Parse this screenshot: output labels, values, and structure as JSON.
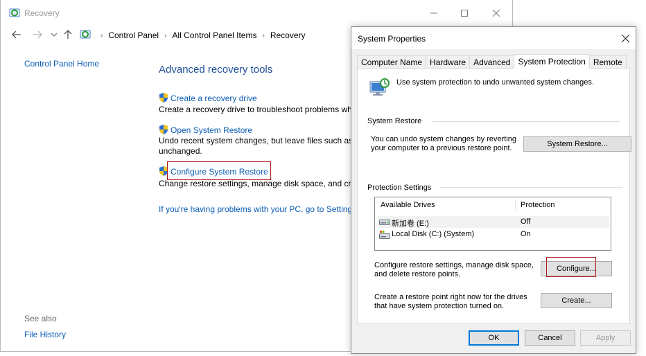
{
  "cp_window": {
    "title": "Recovery",
    "breadcrumb": [
      "Control Panel",
      "All Control Panel Items",
      "Recovery"
    ],
    "left_nav": {
      "home": "Control Panel Home",
      "see_also": "See also",
      "file_history": "File History"
    },
    "heading": "Advanced recovery tools",
    "tasks": [
      {
        "link": "Create a recovery drive",
        "desc": [
          "Create a recovery drive to troubleshoot problems whe"
        ]
      },
      {
        "link": "Open System Restore",
        "desc": [
          "Undo recent system changes, but leave files such as d",
          "unchanged."
        ]
      },
      {
        "link": "Configure System Restore",
        "desc": [
          "Change restore settings, manage disk space, and crea"
        ]
      }
    ],
    "problem_link": "If you're having problems with your PC, go to Setting"
  },
  "sp_dialog": {
    "title": "System Properties",
    "tabs": [
      "Computer Name",
      "Hardware",
      "Advanced",
      "System Protection",
      "Remote"
    ],
    "active_tab": "System Protection",
    "intro": "Use system protection to undo unwanted system changes.",
    "system_restore": {
      "label": "System Restore",
      "desc": "You can undo system changes by reverting your computer to a previous restore point.",
      "button": "System Restore..."
    },
    "protection": {
      "label": "Protection Settings",
      "columns": [
        "Available Drives",
        "Protection"
      ],
      "drives": [
        {
          "name": "新加卷 (E:)",
          "protection": "Off"
        },
        {
          "name": "Local Disk (C:) (System)",
          "protection": "On"
        }
      ],
      "configure_desc": "Configure restore settings, manage disk space, and delete restore points.",
      "configure_button": "Configure...",
      "create_desc": "Create a restore point right now for the drives that have system protection turned on.",
      "create_button": "Create..."
    },
    "buttons": {
      "ok": "OK",
      "cancel": "Cancel",
      "apply": "Apply"
    }
  },
  "colors": {
    "link": "#0b5db5",
    "heading": "#1e4e99",
    "highlight": "#b11b1b",
    "focus": "#0078d7"
  }
}
